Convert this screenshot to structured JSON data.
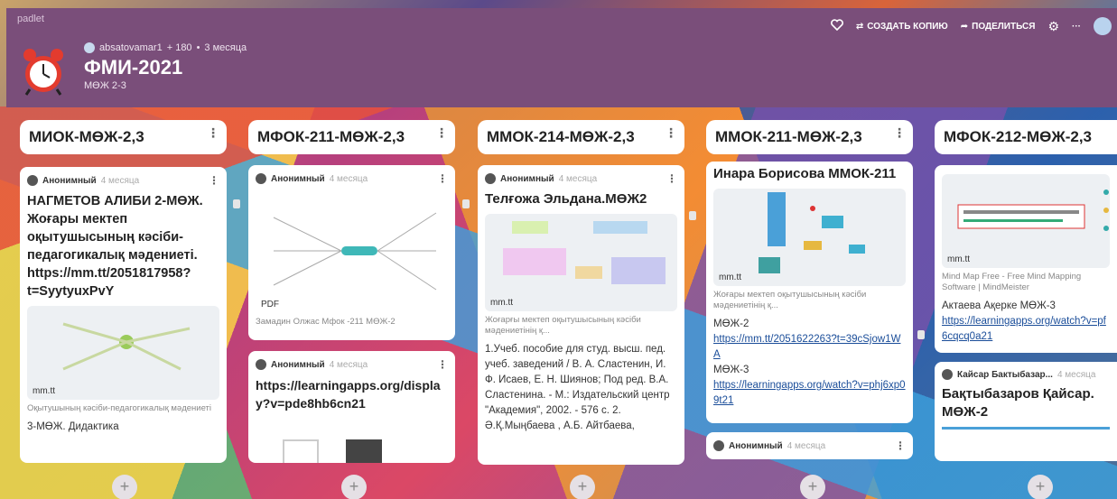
{
  "brand": "padlet",
  "owner": {
    "name": "absatovamar1",
    "plus": "+ 180",
    "sep": "•",
    "age": "3 месяца"
  },
  "board": {
    "title": "ФМИ-2021",
    "subtitle": "МӨЖ 2-3"
  },
  "actions": {
    "copy": "СОЗДАТЬ КОПИЮ",
    "share": "ПОДЕЛИТЬСЯ",
    "more": "···"
  },
  "columns": [
    {
      "title": "МИОК-МӨЖ-2,3"
    },
    {
      "title": "МФОК-211-МӨЖ-2,3"
    },
    {
      "title": "ММОК-214-МӨЖ-2,3"
    },
    {
      "title": "ММОК-211-МӨЖ-2,3"
    },
    {
      "title": "МФОК-212-МӨЖ-2,3"
    }
  ],
  "c1": {
    "author": "Анонимный",
    "time": "4 месяца",
    "title": "НАГМЕТОВ АЛИБИ 2-МӨЖ. Жоғары мектеп оқытушысының кәсіби-педагогикалық мәдениеті. https://mm.tt/2051817958?t=SyytyuxPvY",
    "thumb_label": "mm.tt",
    "sub": "Оқытушының кәсіби-педагогикалық мәдениеті",
    "body": "3-МӨЖ. Дидактика"
  },
  "c2a": {
    "author": "Анонимный",
    "time": "4 месяца",
    "thumb_label": "PDF",
    "sub": "Замадин Олжас Мфок -211 МӨЖ-2"
  },
  "c2b": {
    "author": "Анонимный",
    "time": "4 месяца",
    "title": "https://learningapps.org/display?v=pde8hb6cn21"
  },
  "c3": {
    "author": "Анонимный",
    "time": "4 месяца",
    "title": "Телғожа Эльдана.МӨЖ2",
    "thumb_label": "mm.tt",
    "sub": "Жоғарғы мектеп оқытушысының кәсіби мәдениетінің қ...",
    "body": "1.Учеб. пособие для студ. высш. пед. учеб. заведений / В. А. Сластенин, И. Ф. Исаев, Е. Н. Шиянов; Под ред. В.А. Сластенина. - М.: Издательский центр \"Академия\", 2002. - 576 с. 2. Ә.Қ.Мыңбаева , А.Б. Айтбаева,"
  },
  "c4a": {
    "title": "Инара Борисова ММОК-211",
    "thumb_label": "mm.tt",
    "sub": "Жоғары мектеп оқытушысының кәсіби мәдениетінің қ...",
    "l1": "МӨЖ-2",
    "link1": "https://mm.tt/2051622263?t=39cSjow1WA",
    "l2": "МӨЖ-3",
    "link2": "https://learningapps.org/watch?v=phj6xp09t21"
  },
  "c4b": {
    "author": "Анонимный",
    "time": "4 месяца"
  },
  "c5a": {
    "thumb_label": "mm.tt",
    "sub": "Mind Map Free - Free Mind Mapping Software | MindMeister",
    "body": "Актаева Ақерке МӨЖ-3",
    "link": "https://learningapps.org/watch?v=pf6cqcq0a21"
  },
  "c5b": {
    "author": "Кайсар Бактыбазар...",
    "time": "4 месяца",
    "title": "Бақтыбазаров Қайсар. МӨЖ-2"
  },
  "add_label": "+"
}
